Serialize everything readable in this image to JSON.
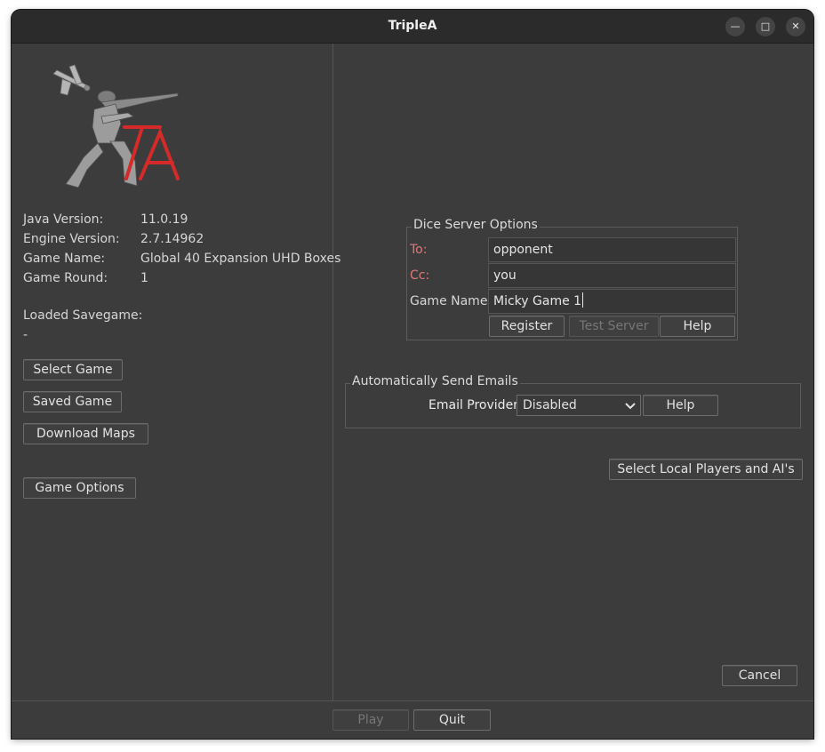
{
  "window": {
    "title": "TripleA"
  },
  "info": {
    "rows": [
      {
        "key": "Java Version:",
        "value": "11.0.19"
      },
      {
        "key": "Engine Version:",
        "value": "2.7.14962"
      },
      {
        "key": "Game Name:",
        "value": "Global 40 Expansion UHD Boxes"
      },
      {
        "key": "Game Round:",
        "value": "1"
      }
    ],
    "loaded_label": "Loaded Savegame:",
    "loaded_value": "-"
  },
  "left_buttons": {
    "select_game": "Select Game",
    "saved_game": "Saved Game",
    "download_maps": "Download Maps",
    "game_options": "Game Options"
  },
  "dice": {
    "legend": "Dice Server Options",
    "to_label": "To:",
    "to_value": "opponent",
    "cc_label": "Cc:",
    "cc_value": "you",
    "game_name_label": "Game Name:",
    "game_name_value": "Micky Game 1",
    "register": "Register",
    "test_server": "Test Server",
    "help": "Help"
  },
  "email": {
    "legend": "Automatically Send Emails",
    "provider_label": "Email Provider",
    "provider_value": "Disabled",
    "help": "Help"
  },
  "select_players": "Select Local Players and AI's",
  "cancel": "Cancel",
  "bottom": {
    "play": "Play",
    "quit": "Quit"
  },
  "colors": {
    "background": "#3c3c3c",
    "titlebar": "#2b2b2b",
    "required_label": "#e07878",
    "logo_red": "#d42a2a"
  }
}
